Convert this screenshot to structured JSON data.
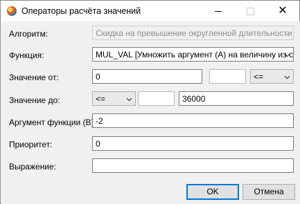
{
  "window": {
    "title": "Операторы расчёта значений"
  },
  "form": {
    "algorithm": {
      "label": "Алгоритм:",
      "value": "Скидка на превышение округленной длительности"
    },
    "function": {
      "label": "Функция:",
      "value": "MUL_VAL [Умножить аргумент (A) на величину из ста"
    },
    "value_from": {
      "label": "Значение от:",
      "value": "0",
      "extra": "",
      "operator": "<="
    },
    "value_to": {
      "label": "Значение до:",
      "operator": "<=",
      "extra": "",
      "value": "36000"
    },
    "arg_b": {
      "label": "Аргумент функции (B):",
      "value": "-2"
    },
    "priority": {
      "label": "Приоритет:",
      "value": "0"
    },
    "expression": {
      "label": "Выражение:",
      "value": ""
    }
  },
  "footer": {
    "ok_label": "OK",
    "cancel_label": "Отмена"
  }
}
